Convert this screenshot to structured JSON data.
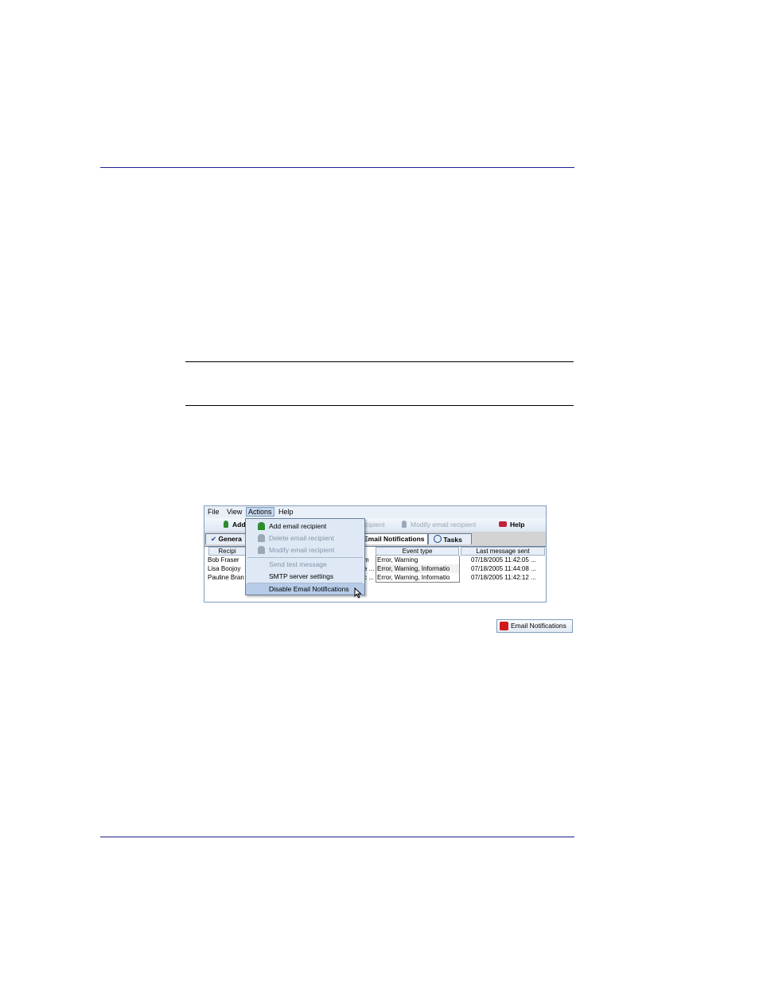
{
  "menubar": {
    "file": "File",
    "view": "View",
    "actions": "Actions",
    "help": "Help"
  },
  "toolbar": {
    "add": "Add",
    "recipient_partial": "cipient",
    "modify": "Modify email recipient",
    "help": "Help"
  },
  "tabs": {
    "general": "Genera",
    "email": "Email Notifications",
    "tasks": "Tasks"
  },
  "table": {
    "headers": {
      "recipient": "Recipi",
      "event_type": "Event type",
      "last_sent": "Last message sent"
    },
    "rows": [
      {
        "name": "Bob Fraser",
        "mid": "m",
        "events": "Error, Warning",
        "last": "07/18/2005 11:42:05 ..."
      },
      {
        "name": "Lisa Boojoy",
        "mid": "e ...",
        "events": "Error, Warning, Informatio",
        "last": "07/18/2005 11:44:08 ..."
      },
      {
        "name": "Pauline Bran",
        "mid": "c ...",
        "events": "Error, Warning, Informatio",
        "last": "07/18/2005 11:42:12 ..."
      }
    ]
  },
  "actions_menu": {
    "add": "Add email recipient",
    "delete": "Delete email recipient",
    "modify": "Modify email recipient",
    "send_test": "Send test message",
    "smtp": "SMTP server settings",
    "disable": "Disable Email Notifications"
  },
  "status_badge": {
    "label": "Email Notifications"
  },
  "colors": {
    "accent": "#1f1f8f",
    "menu_bg": "#dfe9f6",
    "highlight": "#b5cbe8",
    "badge_icon": "#d21a1a"
  }
}
